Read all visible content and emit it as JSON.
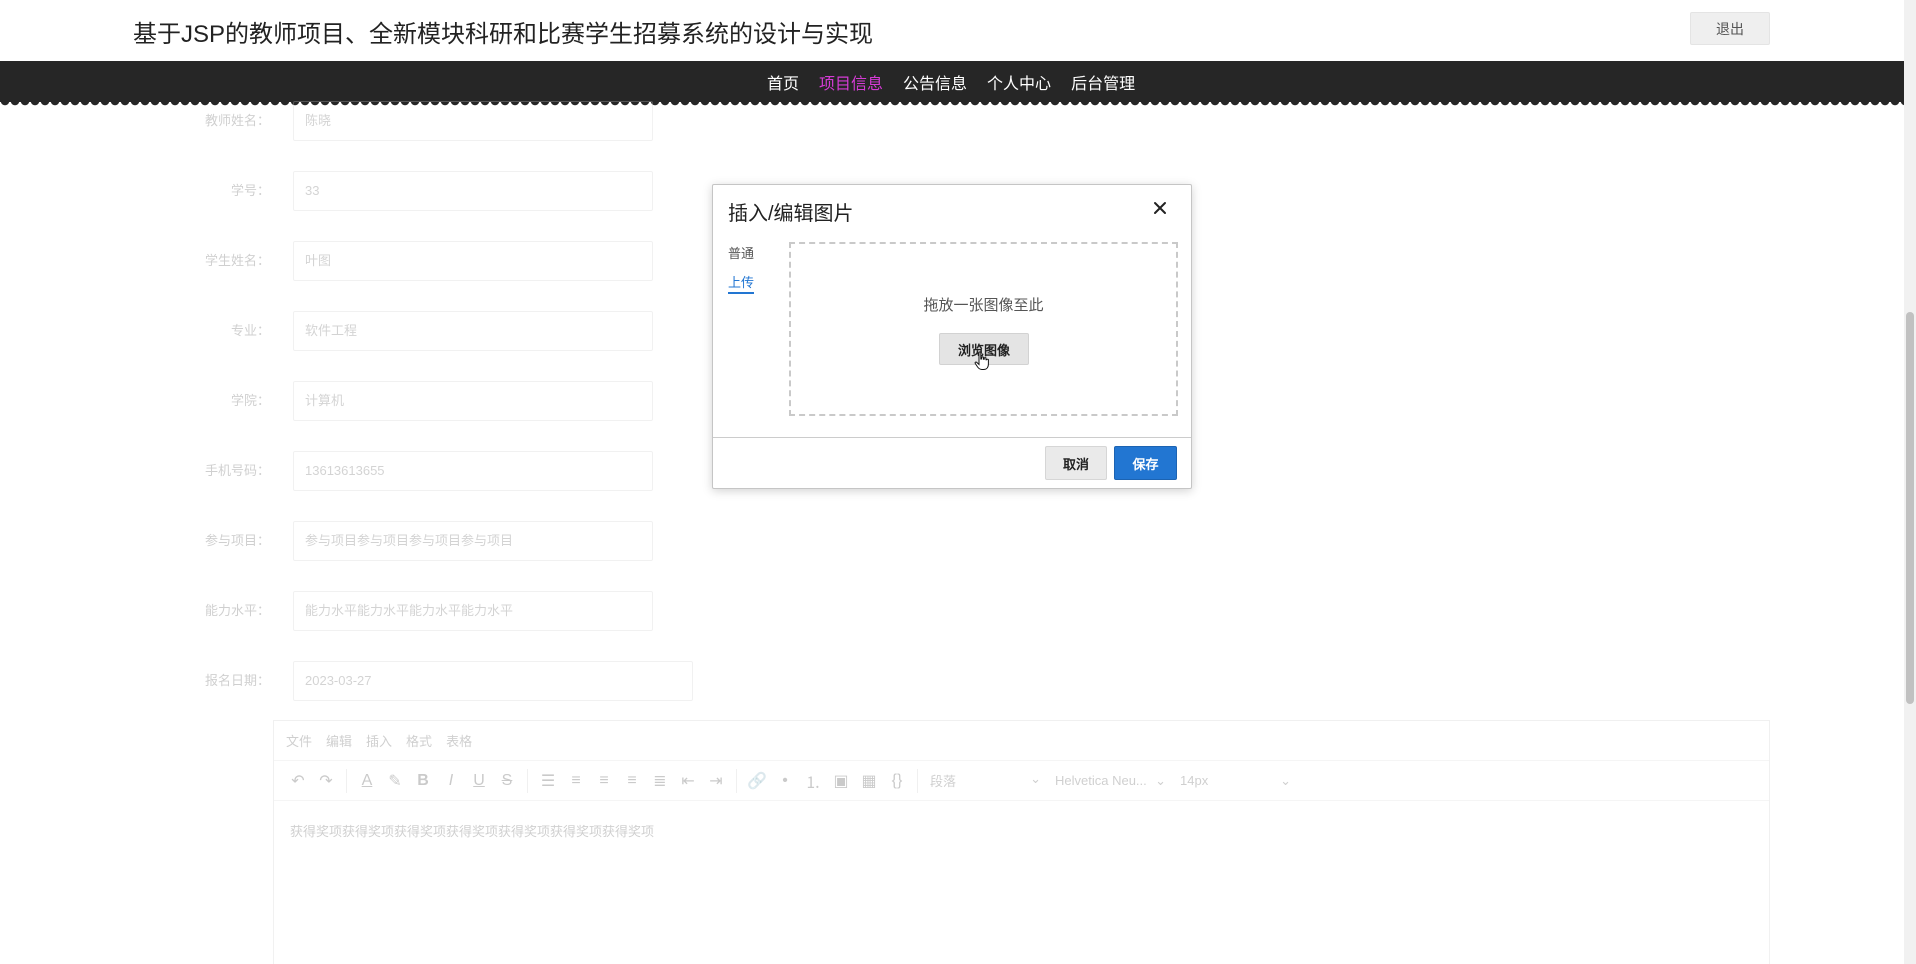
{
  "header": {
    "title": "基于JSP的教师项目、全新模块科研和比赛学生招募系统的设计与实现",
    "logout_label": "退出"
  },
  "nav": {
    "items": [
      {
        "label": "首页"
      },
      {
        "label": "项目信息"
      },
      {
        "label": "公告信息"
      },
      {
        "label": "个人中心"
      },
      {
        "label": "后台管理"
      }
    ]
  },
  "form": {
    "fields": [
      {
        "label": "教师姓名：",
        "value": "陈晓"
      },
      {
        "label": "学号：",
        "value": "33"
      },
      {
        "label": "学生姓名：",
        "value": "叶图"
      },
      {
        "label": "专业：",
        "value": "软件工程"
      },
      {
        "label": "学院：",
        "value": "计算机"
      },
      {
        "label": "手机号码：",
        "value": "13613613655"
      },
      {
        "label": "参与项目：",
        "value": "参与项目参与项目参与项目参与项目"
      },
      {
        "label": "能力水平：",
        "value": "能力水平能力水平能力水平能力水平"
      },
      {
        "label": "报名日期：",
        "value": "2023-03-27"
      }
    ]
  },
  "editor": {
    "menu": [
      "文件",
      "编辑",
      "插入",
      "格式",
      "表格"
    ],
    "paragraph_select": "段落",
    "font_select": "Helvetica Neu...",
    "size_select": "14px",
    "content": "获得奖项获得奖项获得奖项获得奖项获得奖项获得奖项获得奖项"
  },
  "dialog": {
    "title": "插入/编辑图片",
    "tabs": [
      {
        "label": "普通"
      },
      {
        "label": "上传"
      }
    ],
    "drop_text": "拖放一张图像至此",
    "browse_label": "浏览图像",
    "cancel_label": "取消",
    "save_label": "保存"
  },
  "colors": {
    "nav_active": "#d63bd6",
    "primary": "#2276d2",
    "navbar_bg": "#262626"
  }
}
